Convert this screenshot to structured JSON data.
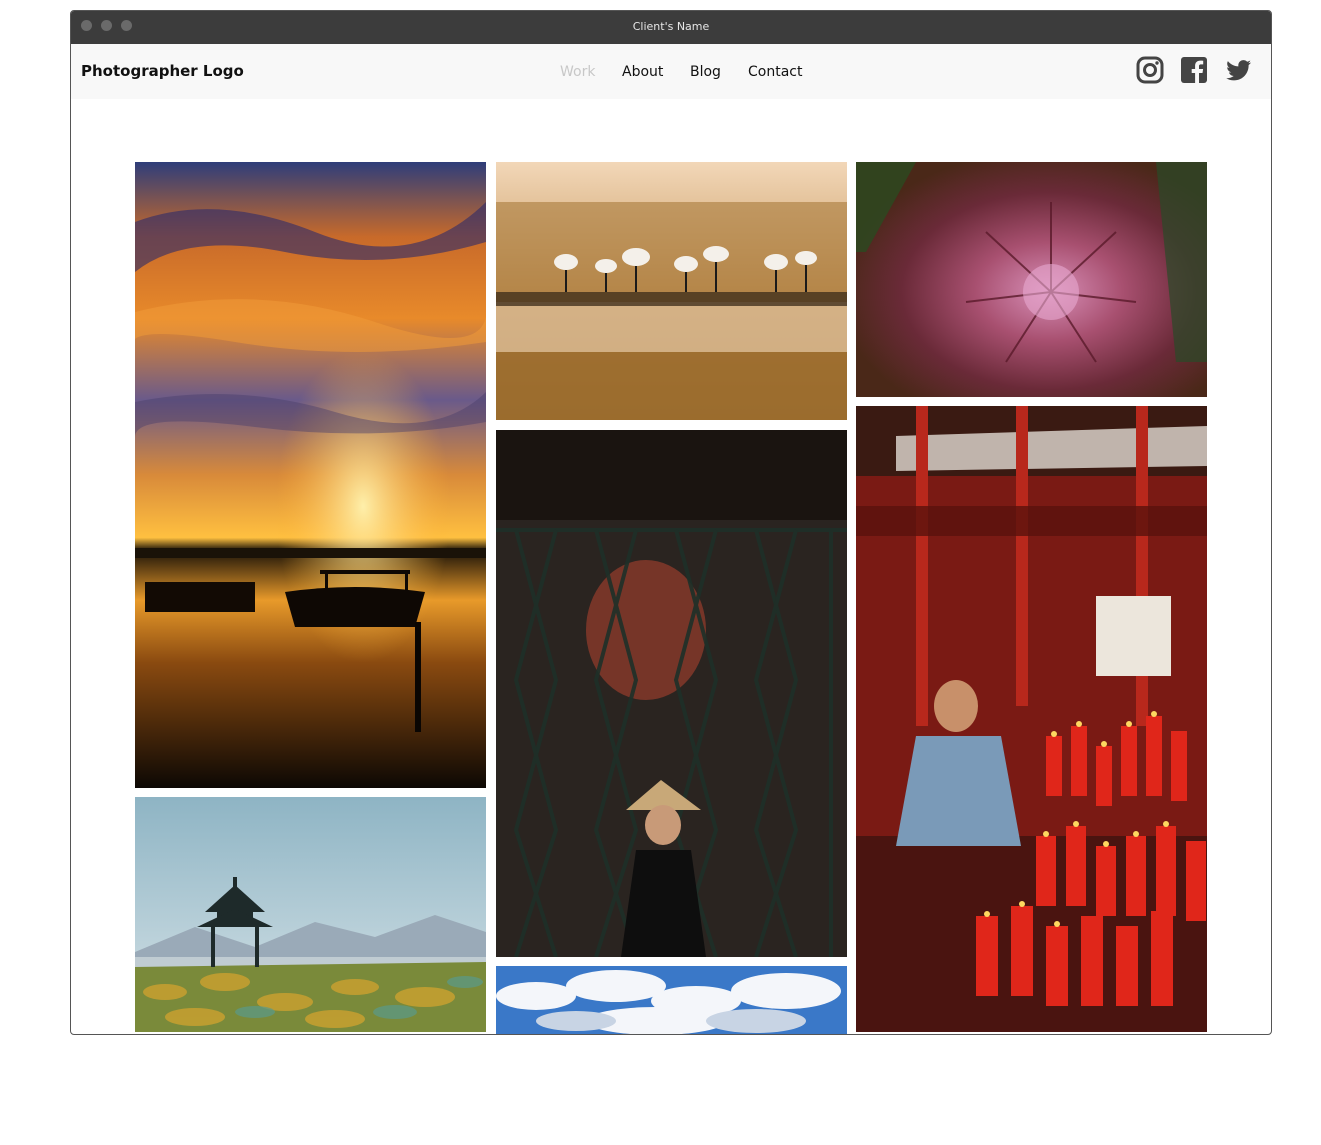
{
  "window": {
    "title": "Client's Name"
  },
  "navbar": {
    "logo": "Photographer Logo",
    "links": [
      {
        "label": "Work",
        "active": true
      },
      {
        "label": "About",
        "active": false
      },
      {
        "label": "Blog",
        "active": false
      },
      {
        "label": "Contact",
        "active": false
      }
    ],
    "social": [
      "instagram-icon",
      "facebook-icon",
      "twitter-icon"
    ]
  },
  "colors": {
    "titlebar": "#3c3c3c",
    "navbar_bg": "#f8f8f8",
    "active_link": "#c8c8c8",
    "icon": "#444444"
  },
  "gallery": {
    "photos": [
      "sunset-boats-photo",
      "cranes-wetland-photo",
      "pink-macro-photo",
      "woman-gate-photo",
      "temple-candles-photo",
      "pagoda-lotus-photo",
      "blue-sky-clouds-photo"
    ]
  }
}
